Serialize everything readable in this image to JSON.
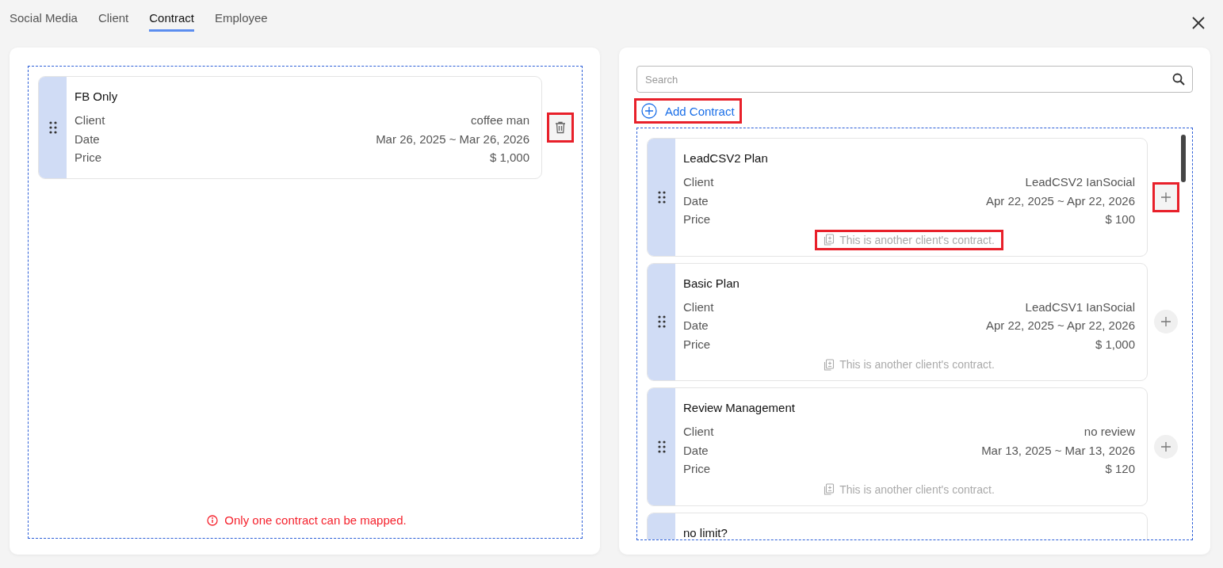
{
  "tabs": [
    {
      "label": "Social Media",
      "selected": false
    },
    {
      "label": "Client",
      "selected": false
    },
    {
      "label": "Contract",
      "selected": true
    },
    {
      "label": "Employee",
      "selected": false
    }
  ],
  "mapped": {
    "contracts": [
      {
        "title": "FB Only",
        "rows": [
          {
            "label": "Client",
            "value": "coffee man"
          },
          {
            "label": "Date",
            "value": "Mar 26, 2025 ~ Mar 26, 2026"
          },
          {
            "label": "Price",
            "value": "$ 1,000"
          }
        ],
        "highlighted": true
      }
    ],
    "warning": "Only one contract can be mapped."
  },
  "available": {
    "search": {
      "placeholder": "Search"
    },
    "add_button": {
      "label": "Add Contract",
      "highlighted": true
    },
    "contracts": [
      {
        "title": "LeadCSV2 Plan",
        "rows": [
          {
            "label": "Client",
            "value": "LeadCSV2 IanSocial"
          },
          {
            "label": "Date",
            "value": "Apr 22, 2025 ~ Apr 22, 2026"
          },
          {
            "label": "Price",
            "value": "$ 100"
          }
        ],
        "note": "This is another client's contract.",
        "note_highlighted": true,
        "highlighted": true
      },
      {
        "title": "Basic Plan",
        "rows": [
          {
            "label": "Client",
            "value": "LeadCSV1 IanSocial"
          },
          {
            "label": "Date",
            "value": "Apr 22, 2025 ~ Apr 22, 2026"
          },
          {
            "label": "Price",
            "value": "$ 1,000"
          }
        ],
        "note": "This is another client's contract.",
        "note_highlighted": false,
        "highlighted": false
      },
      {
        "title": "Review Management",
        "rows": [
          {
            "label": "Client",
            "value": "no review"
          },
          {
            "label": "Date",
            "value": "Mar 13, 2025 ~ Mar 13, 2026"
          },
          {
            "label": "Price",
            "value": "$ 120"
          }
        ],
        "note": "This is another client's contract.",
        "note_highlighted": false,
        "highlighted": false
      },
      {
        "title": "no limit?"
      }
    ]
  }
}
